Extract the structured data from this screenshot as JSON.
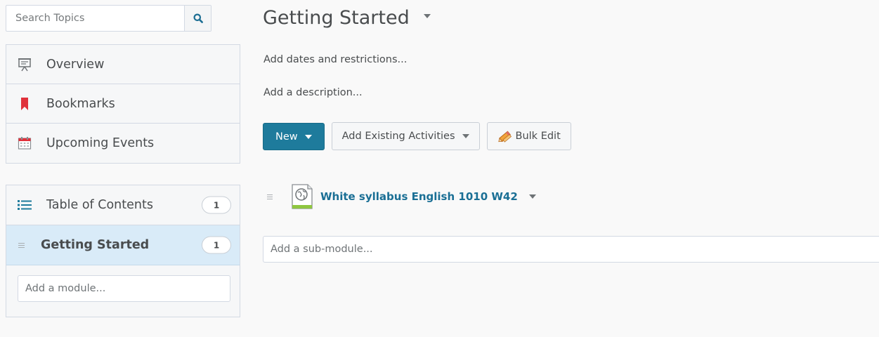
{
  "search": {
    "placeholder": "Search Topics"
  },
  "nav": {
    "items": [
      {
        "label": "Overview",
        "icon": "presentation-board-icon"
      },
      {
        "label": "Bookmarks",
        "icon": "bookmark-icon"
      },
      {
        "label": "Upcoming Events",
        "icon": "calendar-icon"
      }
    ]
  },
  "toc": {
    "label": "Table of Contents",
    "count": "1",
    "modules": [
      {
        "label": "Getting Started",
        "count": "1"
      }
    ],
    "add_module_placeholder": "Add a module..."
  },
  "main": {
    "title": "Getting Started",
    "add_dates_link": "Add dates and restrictions...",
    "add_description_link": "Add a description...",
    "toolbar": {
      "new_label": "New",
      "add_existing_label": "Add Existing Activities",
      "bulk_edit_label": "Bulk Edit"
    },
    "topics": [
      {
        "title": "White syllabus English 1010 W42",
        "icon": "web-page-icon"
      }
    ],
    "add_submodule_placeholder": "Add a sub-module..."
  },
  "colors": {
    "primary_button": "#1e7b9c",
    "topic_link": "#1a6f95",
    "active_module_bg": "#d9ebf8",
    "bookmark_red": "#e0313b"
  }
}
